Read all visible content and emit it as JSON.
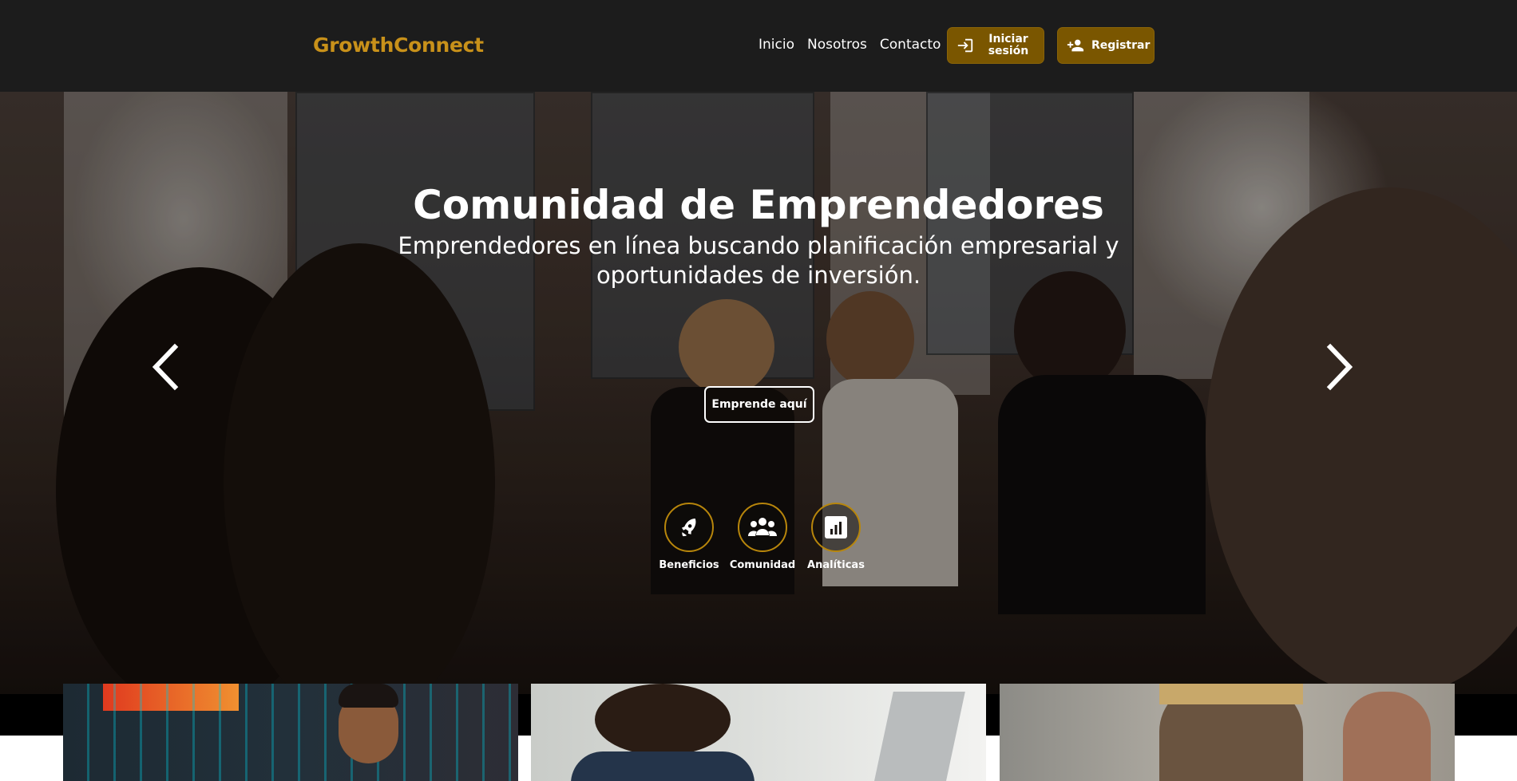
{
  "header": {
    "brand": "GrowthConnect",
    "nav": [
      "Inicio",
      "Nosotros",
      "Contacto"
    ],
    "login_label": "Iniciar sesión",
    "register_label": "Registrar"
  },
  "hero": {
    "title": "Comunidad de Emprendedores",
    "subtitle": "Emprendedores en línea buscando planificación empresarial y oportunidades de inversión.",
    "cta_label": "Emprende aquí",
    "features": [
      {
        "label": "Beneficios",
        "icon": "rocket-icon"
      },
      {
        "label": "Comunidad",
        "icon": "users-icon"
      },
      {
        "label": "Analíticas",
        "icon": "chart-icon"
      }
    ]
  },
  "colors": {
    "brand": "#c8911a",
    "button": "#7a5600",
    "header_bg": "#1c1c1c"
  }
}
